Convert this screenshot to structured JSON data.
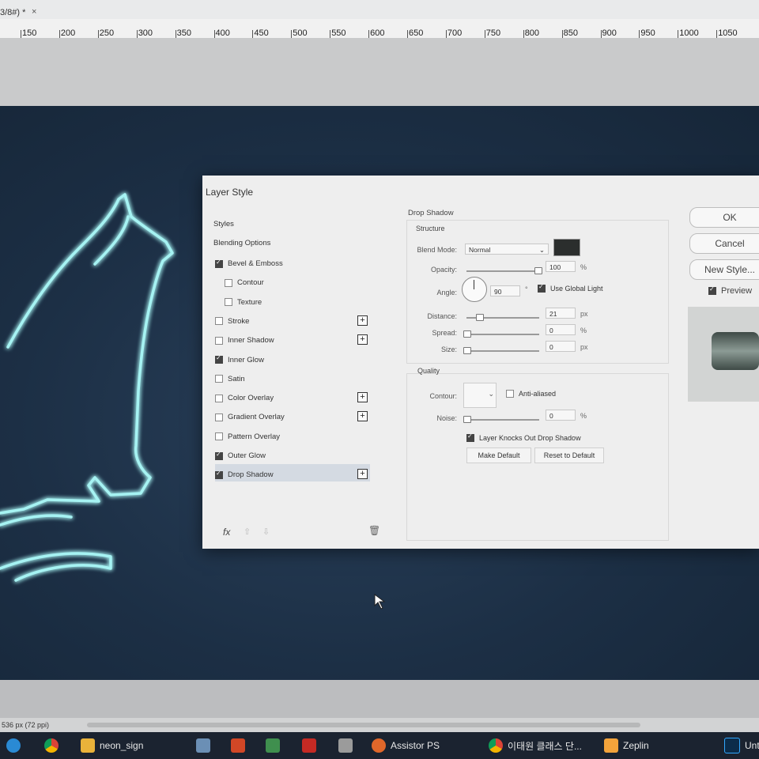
{
  "document": {
    "tab_label": "3/8#) *",
    "close_glyph": "×"
  },
  "ruler": {
    "ticks": [
      "150",
      "200",
      "250",
      "300",
      "350",
      "400",
      "450",
      "500",
      "550",
      "600",
      "650",
      "700",
      "750",
      "800",
      "850",
      "900",
      "950",
      "1000",
      "1050"
    ]
  },
  "dialog": {
    "title": "Layer Style",
    "styles_panel": {
      "header": "Styles",
      "blending_options": "Blending Options",
      "items": [
        {
          "label": "Bevel & Emboss",
          "checked": true,
          "plus": false,
          "indent": false
        },
        {
          "label": "Contour",
          "checked": false,
          "plus": false,
          "indent": true
        },
        {
          "label": "Texture",
          "checked": false,
          "plus": false,
          "indent": true
        },
        {
          "label": "Stroke",
          "checked": false,
          "plus": true,
          "indent": false
        },
        {
          "label": "Inner Shadow",
          "checked": false,
          "plus": true,
          "indent": false
        },
        {
          "label": "Inner Glow",
          "checked": true,
          "plus": false,
          "indent": false
        },
        {
          "label": "Satin",
          "checked": false,
          "plus": false,
          "indent": false
        },
        {
          "label": "Color Overlay",
          "checked": false,
          "plus": true,
          "indent": false
        },
        {
          "label": "Gradient Overlay",
          "checked": false,
          "plus": true,
          "indent": false
        },
        {
          "label": "Pattern Overlay",
          "checked": false,
          "plus": false,
          "indent": false
        },
        {
          "label": "Outer Glow",
          "checked": true,
          "plus": false,
          "indent": false
        },
        {
          "label": "Drop Shadow",
          "checked": true,
          "plus": true,
          "indent": false,
          "selected": true
        }
      ],
      "fx_label": "fx"
    },
    "drop_shadow": {
      "section_title": "Drop Shadow",
      "structure_title": "Structure",
      "blend_mode_label": "Blend Mode:",
      "blend_mode_value": "Normal",
      "shadow_color": "#2b2e2d",
      "opacity_label": "Opacity:",
      "opacity_value": "100",
      "opacity_unit": "%",
      "angle_label": "Angle:",
      "angle_value": "90",
      "angle_unit": "°",
      "use_global_light_label": "Use Global Light",
      "use_global_light": true,
      "distance_label": "Distance:",
      "distance_value": "21",
      "distance_unit": "px",
      "spread_label": "Spread:",
      "spread_value": "0",
      "spread_unit": "%",
      "size_label": "Size:",
      "size_value": "0",
      "size_unit": "px",
      "quality_title": "Quality",
      "contour_label": "Contour:",
      "anti_aliased_label": "Anti-aliased",
      "noise_label": "Noise:",
      "noise_value": "0",
      "noise_unit": "%",
      "knocks_out_label": "Layer Knocks Out Drop Shadow",
      "knocks_out": true,
      "make_default_label": "Make Default",
      "reset_default_label": "Reset to Default"
    },
    "buttons": {
      "ok": "OK",
      "cancel": "Cancel",
      "new_style": "New Style...",
      "preview_label": "Preview",
      "preview_checked": true
    }
  },
  "status_bar": {
    "doc_info": "536 px (72 ppi)"
  },
  "taskbar": {
    "items": [
      {
        "label": "neon_sign",
        "icon": "folder-icon"
      },
      {
        "label": "Assistor PS",
        "icon": "assistor-icon"
      },
      {
        "label": "이태원 클래스 단...",
        "icon": "chrome-icon"
      },
      {
        "label": "Zeplin",
        "icon": "zeplin-icon"
      },
      {
        "label": "Unt",
        "icon": "photoshop-icon"
      }
    ]
  },
  "colors": {
    "neon": "#9ff0f0",
    "canvas": "#1e3148",
    "dialog_bg": "#eeeeee"
  }
}
